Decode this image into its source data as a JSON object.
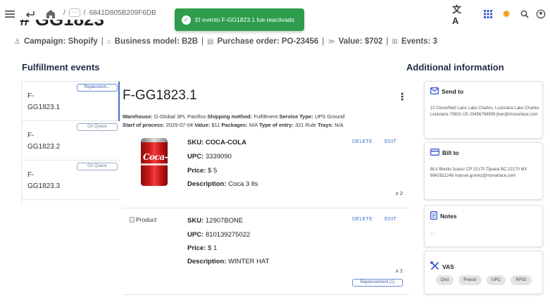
{
  "topbar": {
    "menu_icon": "menu-icon",
    "back_icon": "back-arrow-icon",
    "home_icon": "home-icon",
    "crumb_sep": "/",
    "crumb_more": "···",
    "crumb_id": "6841D805B209F6DB",
    "translate_icon": "translate-icon",
    "apps_icon": "apps-grid-icon",
    "settings_icon": "gear-icon",
    "search_icon": "search-icon"
  },
  "toast": {
    "message": "El evento F-GG1823.1 fue reactivado",
    "color": "#2e9d4d"
  },
  "header": {
    "partial_title": "# GG1823",
    "campaign": "Campaign: Shopify",
    "business_model": "Business model: B2B",
    "purchase_order": "Purchase order: PO-23456",
    "value": "Value: $702",
    "events": "Events: 3",
    "separator": "|"
  },
  "fulfillment": {
    "heading": "Fulfillment events",
    "items": [
      {
        "name": "F-GG1823.1",
        "status": "Replenishm...",
        "active": true
      },
      {
        "name": "F-GG1823.2",
        "status": "On Queue",
        "active": false
      },
      {
        "name": "F-GG1823.3",
        "status": "On Queue",
        "active": false
      }
    ]
  },
  "detail": {
    "title": "F-GG1823.1",
    "warehouse_label": "Warehouse:",
    "warehouse": "G-Global 3PL Pacifico",
    "shipping_label": "Shipping method:",
    "shipping": "Fulfillment",
    "service_label": "Service Type:",
    "service": "UPS Ground",
    "start_label": "Start of process:",
    "start": "2025-07-04",
    "value_label": "Value:",
    "value": "$11",
    "packages_label": "Packages:",
    "packages": "N/A",
    "entry_label": "Type of entry:",
    "entry": "321 Rule",
    "trays_label": "Trays:",
    "trays": "N/A",
    "delete_label": "DELETE",
    "edit_label": "EDIT",
    "sku_label": "SKU:",
    "upc_label": "UPC:",
    "price_label": "Price:",
    "desc_label": "Description:",
    "products": [
      {
        "sku": "COCA-COLA",
        "upc": "3339090",
        "price": "$ 5",
        "description": "Coca 3 lts",
        "qty": "x 2",
        "image_alt": "",
        "logo_text": "Coca-Cola",
        "chip": ""
      },
      {
        "sku": "12907BONE",
        "upc": "810139275022",
        "price": "$ 1",
        "description": "WINTER HAT",
        "qty": "x 1",
        "image_alt": "Product",
        "chip": "Replenishment (1)"
      }
    ]
  },
  "additional": {
    "heading": "Additional information",
    "send_to": {
      "title": "Send to",
      "icon": "mail-icon",
      "text": "10 Cloverfield Lane Lake Charles, Louisiana Lake Charles Louisiana 70601 US 23456789999 jhon@monarlace.com"
    },
    "bill_to": {
      "title": "Bill to",
      "icon": "credit-card-icon",
      "text": "BLV Benito Juarez CP 22170 Tijuana BC 22170 MX 6642811248 manuel.gomez@monarlace.com"
    },
    "notes": {
      "title": "Notes",
      "icon": "notes-icon",
      "text": "- -"
    },
    "vas": {
      "title": "VAS",
      "icon": "tools-icon",
      "chips": [
        "Dist",
        "Precio",
        "UPC",
        "RFID"
      ]
    }
  }
}
